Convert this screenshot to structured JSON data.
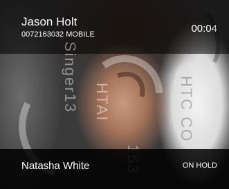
{
  "active_call": {
    "name": "Jason Holt",
    "number": "0072163032 MOBILE",
    "timer": "00:04"
  },
  "held_call": {
    "name": "Natasha White",
    "status": "ON HOLD"
  },
  "watermark": {
    "lines": [
      "Singer13",
      "HTAI",
      "153",
      "HTC CO"
    ]
  },
  "colors": {
    "overlay": "#000000",
    "text": "#ffffff"
  }
}
